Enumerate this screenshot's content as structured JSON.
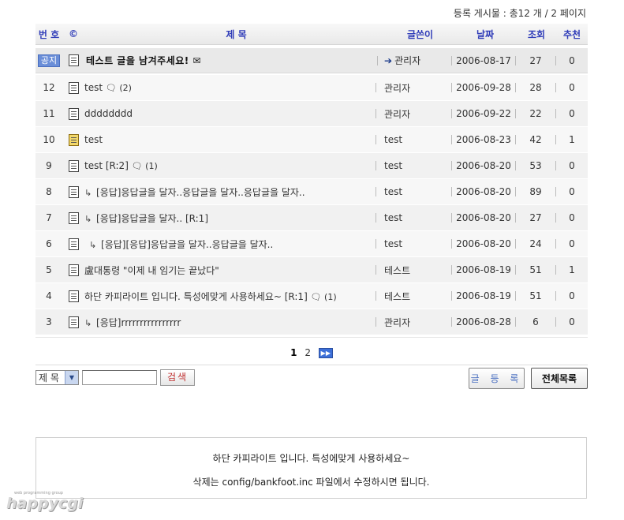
{
  "stats": "등록 게시물 : 총12 개 / 2 페이지",
  "header": {
    "num": "번 호",
    "copyright": "©",
    "title": "제 목",
    "writer": "글쓴이",
    "date": "날짜",
    "views": "조회",
    "recommend": "추천"
  },
  "notice": {
    "badge": "공지",
    "title": "테스트 글을 남겨주세요! ✉",
    "writer": "관리자",
    "date": "2006-08-17",
    "views": "27",
    "recommend": "0"
  },
  "rows": [
    {
      "num": "12",
      "prefix": "",
      "title": "test",
      "comment": "🗨 (2)",
      "writer": "관리자",
      "date": "2006-09-28",
      "views": "28",
      "rec": "0",
      "icon": "document-icon"
    },
    {
      "num": "11",
      "prefix": "",
      "title": "dddddddd",
      "comment": "",
      "writer": "관리자",
      "date": "2006-09-22",
      "views": "22",
      "rec": "0",
      "icon": "document-icon"
    },
    {
      "num": "10",
      "prefix": "",
      "title": "test",
      "comment": "",
      "writer": "test",
      "date": "2006-08-23",
      "views": "42",
      "rec": "1",
      "icon": "multi-document-icon"
    },
    {
      "num": "9",
      "prefix": "",
      "title": "test [R:2]",
      "comment": "🗨 (1)",
      "writer": "test",
      "date": "2006-08-20",
      "views": "53",
      "rec": "0",
      "icon": "document-icon"
    },
    {
      "num": "8",
      "prefix": "↳",
      "title": "[응답]응답글을 달자..응답글을 달자..응답글을 달자..",
      "comment": "",
      "writer": "test",
      "date": "2006-08-20",
      "views": "89",
      "rec": "0",
      "icon": "document-icon"
    },
    {
      "num": "7",
      "prefix": "↳",
      "title": "[응답]응답글을 달자.. [R:1]",
      "comment": "",
      "writer": "test",
      "date": "2006-08-20",
      "views": "27",
      "rec": "0",
      "icon": "document-icon"
    },
    {
      "num": "6",
      "prefix": "↳",
      "title": "[응답][응답]응답글을 달자..응답글을 달자..",
      "comment": "",
      "writer": "test",
      "date": "2006-08-20",
      "views": "24",
      "rec": "0",
      "icon": "document-icon",
      "deep": true
    },
    {
      "num": "5",
      "prefix": "",
      "title": "盧대통령 \"이제 내 임기는 끝났다\"",
      "comment": "",
      "writer": "테스트",
      "date": "2006-08-19",
      "views": "51",
      "rec": "1",
      "icon": "document-icon"
    },
    {
      "num": "4",
      "prefix": "",
      "title": "하단 카피라이트 입니다. 특성에맞게 사용하세요~ [R:1]",
      "comment": "🗨 (1)",
      "writer": "테스트",
      "date": "2006-08-19",
      "views": "51",
      "rec": "0",
      "icon": "document-icon"
    },
    {
      "num": "3",
      "prefix": "↳",
      "title": "[응답]rrrrrrrrrrrrrrrr",
      "comment": "",
      "writer": "관리자",
      "date": "2006-08-28",
      "views": "6",
      "rec": "0",
      "icon": "document-icon"
    }
  ],
  "pager": {
    "current": "1",
    "other": "2",
    "next_icon": "next-page-icon"
  },
  "search": {
    "field": "제 목",
    "button": "검색"
  },
  "buttons": {
    "write": "글 등 록",
    "list": "전체목록"
  },
  "footer": {
    "line1": "하단 카피라이트 입니다. 특성에맞게 사용하세요~",
    "line2": "삭제는 config/bankfoot.inc 파일에서 수정하시면 됩니다."
  },
  "logo": {
    "small": "web programming group",
    "big": "happycgi"
  }
}
